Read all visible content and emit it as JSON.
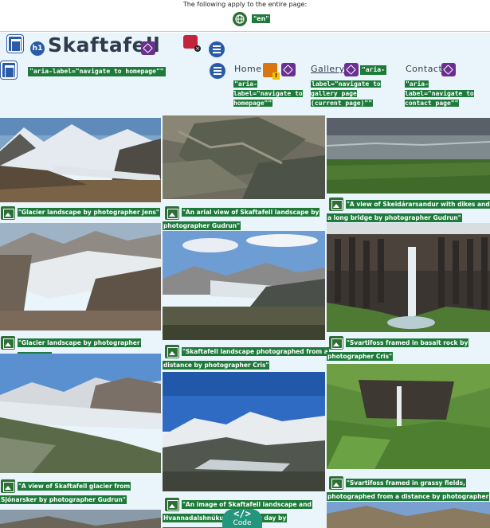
{
  "top": {
    "notice": "The following apply to the entire page:",
    "lang": "\"en\""
  },
  "header": {
    "title": "Skaftafell",
    "home_aria": "\"aria-label=\"navigate to homepage\"\"",
    "nav": [
      {
        "label": "Home",
        "aria": "\"aria-label=\"navigate to homepage\"\""
      },
      {
        "label": "Gallery",
        "aria_tag": "\"aria-",
        "aria": "label=\"navigate to gallery page (current page)\"\""
      },
      {
        "label": "Contact",
        "aria": "\"aria-label=\"navigate to contact page\"\""
      }
    ]
  },
  "gallery": {
    "captions": [
      "\"Glacier landscape by photographer Jens\"",
      "\"An arial view of Skaftafell landscape by photographer Gudrun\"",
      "\"A view of Skeidárarsandur with dikes and a long bridge by photographer Gudrun\"",
      "\"Glacier landscape by photographer Wopstah\"",
      "\"Skaftafell landscape photographed from a distance by photographer Cris\"",
      "\"Svartifoss framed in basalt rock by photographer Cris\"",
      "\"A view of Skaftafell glacier from Sjónarsker by photographer Gudrun\"",
      "\"Svartifoss framed in grassy fields, photographed from a distance by photographer Ronile\"",
      "\"An image of Skaftafell landscape and Hvannadalshnúkur on a clear day by photographer Gudrun\""
    ]
  },
  "code_button": {
    "symbol": "</>",
    "label": "Code"
  },
  "colors": {
    "annotation_green": "#1e7a3a",
    "header_bg": "#eaf5fb",
    "title": "#2f3b4c",
    "accent_blue": "#2b5ba8",
    "tag_purple": "#6a2f8f"
  }
}
